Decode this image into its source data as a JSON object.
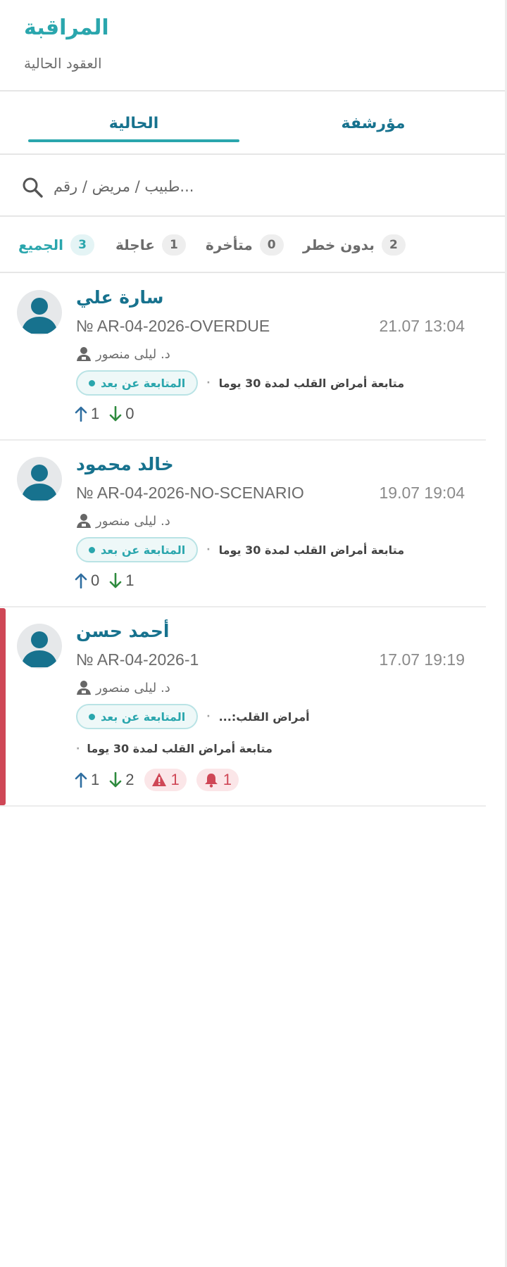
{
  "header": {
    "title": "المراقبة",
    "subtitle": "العقود الحالية"
  },
  "tabs": {
    "current": "الحالية",
    "archived": "مؤرشفة"
  },
  "search": {
    "placeholder": "...طبيب / مريض / رقم"
  },
  "filters": [
    {
      "label": "الجميع",
      "count": "3",
      "active": true
    },
    {
      "label": "عاجلة",
      "count": "1"
    },
    {
      "label": "متأخرة",
      "count": "0"
    },
    {
      "label": "بدون خطر",
      "count": "2"
    }
  ],
  "colors": {
    "accent": "#2aa6ad",
    "name": "#17728e",
    "urgent": "#cf4756",
    "up": "#2f6ea0",
    "down": "#2e8a3e"
  },
  "contracts": [
    {
      "name": "سارة علي",
      "number": "№ AR-04-2026-OVERDUE",
      "date": "21.07 13:04",
      "doctor": "د. ليلى منصور",
      "status": "المتابعة عن بعد",
      "program": "متابعة أمراض القلب لمدة 30 يوما",
      "up": "1",
      "down": "0"
    },
    {
      "name": "خالد محمود",
      "number": "№ AR-04-2026-NO-SCENARIO",
      "date": "19.07 19:04",
      "doctor": "د. ليلى منصور",
      "status": "المتابعة عن بعد",
      "program": "متابعة أمراض القلب لمدة 30 يوما",
      "up": "0",
      "down": "1"
    },
    {
      "name": "أحمد حسن",
      "number": "№ AR-04-2026-1",
      "date": "17.07 19:19",
      "doctor": "د. ليلى منصور",
      "status": "المتابعة عن بعد",
      "program": "...:أمراض القلب",
      "program2": "متابعة أمراض القلب لمدة 30 يوما",
      "up": "1",
      "down": "2",
      "warnings": "1",
      "alarms": "1",
      "urgent": true
    }
  ]
}
